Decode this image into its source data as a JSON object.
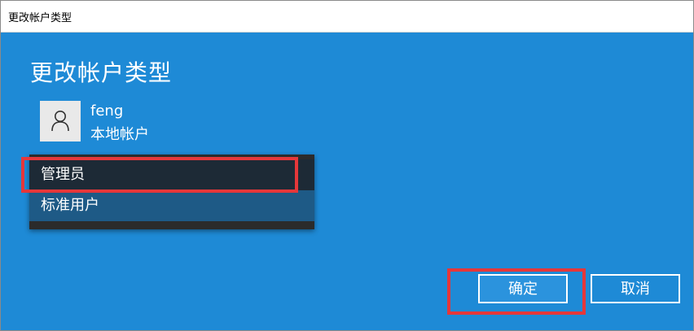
{
  "window": {
    "title": "更改帐户类型"
  },
  "dialog": {
    "heading": "更改帐户类型"
  },
  "user": {
    "name": "feng",
    "account_type": "本地帐户",
    "avatar_icon": "person-icon"
  },
  "account_type_dropdown": {
    "options": [
      {
        "label": "管理员",
        "state": "hovered"
      },
      {
        "label": "标准用户",
        "state": "selected"
      }
    ]
  },
  "buttons": {
    "ok_label": "确定",
    "cancel_label": "取消"
  },
  "colors": {
    "dialog_background": "#1e8ad6",
    "highlight_annotation": "#e5373a",
    "dropdown_background": "#2b2b2b"
  }
}
